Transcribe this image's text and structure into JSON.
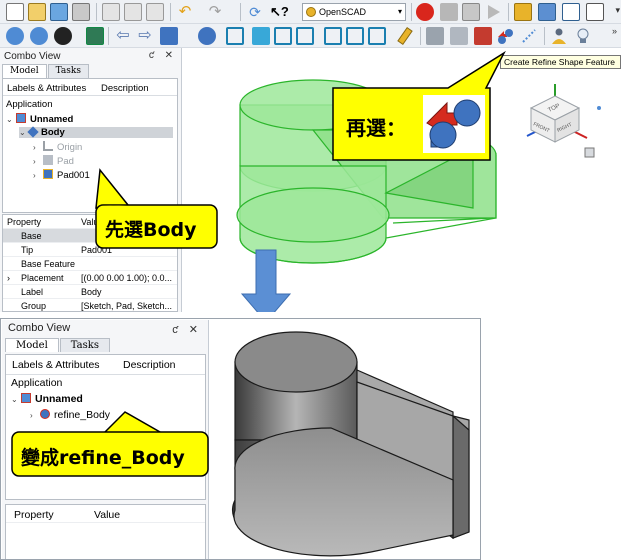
{
  "top": {
    "toolbar": {
      "workbench_selector": "OpenSCAD"
    },
    "tooltip": "Create Refine Shape Feature",
    "combo_view": {
      "title": "Combo View",
      "window_buttons": "ƈ ✕",
      "tabs": [
        {
          "label": "Model"
        },
        {
          "label": "Tasks"
        }
      ],
      "tree_header": {
        "col1": "Labels & Attributes",
        "col2": "Description"
      },
      "application_label": "Application",
      "tree": {
        "root": "Unnamed",
        "body": "Body",
        "origin": "Origin",
        "pad": "Pad",
        "pad001": "Pad001"
      },
      "property_header": {
        "col1": "Property",
        "col2": "Valu"
      },
      "properties": [
        {
          "name": "Base",
          "value": ""
        },
        {
          "name": "Tip",
          "value": "Pad001"
        },
        {
          "name": "Base Feature",
          "value": ""
        },
        {
          "name": "Placement",
          "value": "[(0.00 0.00 1.00); 0.0..."
        },
        {
          "name": "Label",
          "value": "Body"
        },
        {
          "name": "Group",
          "value": "[Sketch, Pad, Sketch..."
        }
      ]
    },
    "navcube": {
      "label_top": "TOP",
      "label_right": "RIGHT",
      "label_front": "FRONT"
    },
    "callout_select": {
      "prefix": "先選",
      "suffix": "Body"
    },
    "callout_then": {
      "text": "再選："
    }
  },
  "bottom": {
    "combo_view": {
      "title": "Combo View",
      "window_buttons": "ƈ ✕",
      "tabs": [
        {
          "label": "Model"
        },
        {
          "label": "Tasks"
        }
      ],
      "tree_header": {
        "col1": "Labels & Attributes",
        "col2": "Description"
      },
      "application_label": "Application",
      "tree": {
        "root": "Unnamed",
        "refine": "refine_Body"
      },
      "property_header": {
        "col1": "Property",
        "col2": "Value"
      }
    },
    "callout_result": {
      "prefix": "變成",
      "suffix": "refine_Body"
    }
  },
  "colors": {
    "callout_fill": "#ffff00",
    "callout_stroke": "#000000",
    "arrow_blue": "#5b8fd4",
    "shape_green_fill": "#9ee89a",
    "shape_green_stroke": "#2bb52b",
    "selection_gray": "#cfd3d8"
  }
}
